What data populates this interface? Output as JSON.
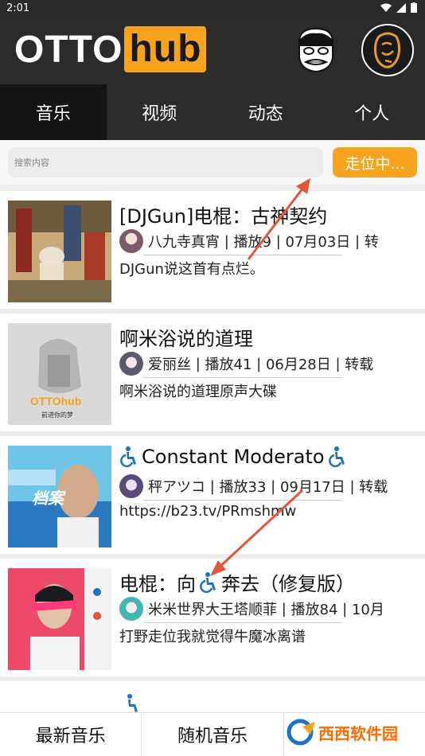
{
  "status": {
    "time": "2:01"
  },
  "header": {
    "logo_otto": "OTTO",
    "logo_hub": "hub"
  },
  "tabs": [
    {
      "label": "音乐",
      "active": true
    },
    {
      "label": "视频",
      "active": false
    },
    {
      "label": "动态",
      "active": false
    },
    {
      "label": "个人",
      "active": false
    }
  ],
  "search": {
    "placeholder": "搜索内容",
    "button_label": "走位中..."
  },
  "cards": [
    {
      "title": "[DJGun]电棍：古神契约",
      "author": "八九寺真宵",
      "plays": "播放9",
      "date": "07月03日",
      "extra": "转",
      "desc": "DJGun说这首有点烂。"
    },
    {
      "title": "啊米浴说的道理",
      "author": "爱丽丝",
      "plays": "播放41",
      "date": "06月28日",
      "extra": "转载",
      "desc": "啊米浴说的道理原声大碟",
      "thumb_text": "OTTOhub",
      "thumb_sub": "前进你的梦"
    },
    {
      "title_text": "Constant Moderato",
      "author": "秤アツコ",
      "plays": "播放33",
      "date": "09月17日",
      "extra": "转载",
      "desc": "https://b23.tv/PRmshmw",
      "thumb_text": "档案"
    },
    {
      "title_a": "电棍：向",
      "title_b": "奔去（修复版）",
      "author": "米米世界大王塔顺菲",
      "plays": "播放84",
      "date": "10月",
      "desc": "打野走位我就觉得牛魔冰离谱"
    }
  ],
  "bottom_nav": [
    {
      "label": "最新音乐"
    },
    {
      "label": "随机音乐"
    }
  ],
  "watermark": {
    "text": "西西软件园"
  },
  "colors": {
    "accent": "#f7a31d",
    "header_bg": "#2b2b2b",
    "tab_active_bg": "#151515",
    "wheelchair_blue": "#1e73be",
    "arrow_red": "#e2553a"
  }
}
